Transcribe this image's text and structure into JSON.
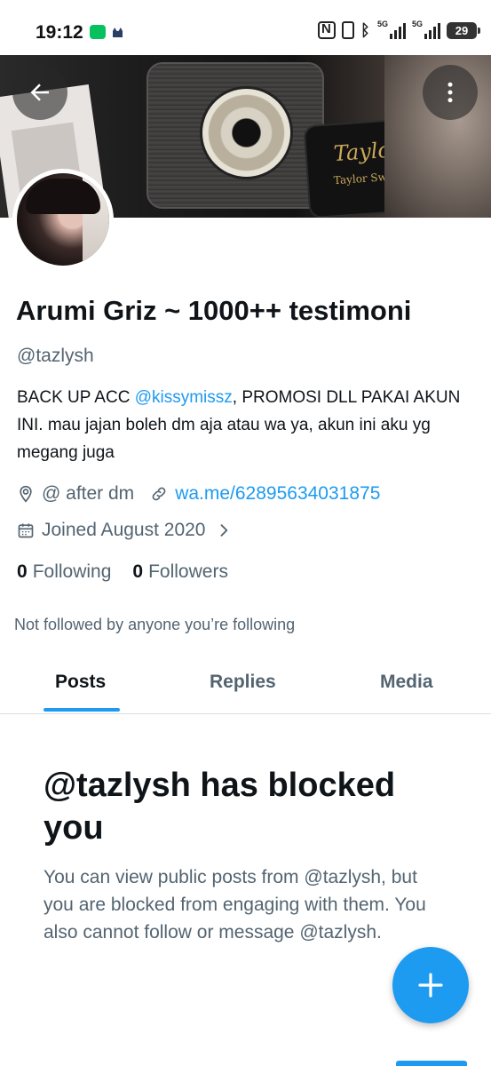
{
  "status_bar": {
    "time": "19:12",
    "network_labels": [
      "5G",
      "5G"
    ],
    "battery": "29"
  },
  "banner": {
    "pouch_text": "Taylor Swift",
    "pouch_signature": "Taylor"
  },
  "profile": {
    "name": "Arumi Griz ~ 1000++ testimoni",
    "handle": "@tazlysh",
    "bio_before": "BACK UP ACC ",
    "bio_mention": "@kissymissz",
    "bio_after": ", PROMOSI DLL PAKAI AKUN INI. mau jajan boleh dm aja atau wa ya, akun ini aku yg megang juga",
    "location": "@ after dm",
    "website": "wa.me/62895634031875",
    "joined": "Joined August 2020",
    "following_count": "0",
    "following_label": "Following",
    "followers_count": "0",
    "followers_label": "Followers",
    "not_followed_note": "Not followed by anyone you’re following"
  },
  "tabs": [
    {
      "label": "Posts",
      "active": true
    },
    {
      "label": "Replies",
      "active": false
    },
    {
      "label": "Media",
      "active": false
    }
  ],
  "blocked": {
    "title": "@tazlysh has blocked you",
    "description": "You can view public posts from @tazlysh, but you are blocked from engaging with them. You also cannot follow or message @tazlysh."
  },
  "colors": {
    "accent": "#1d9bf0",
    "secondary_text": "#536471",
    "primary_text": "#0f1419"
  },
  "icons": {
    "back": "arrow-left-icon",
    "more": "more-vertical-icon",
    "location": "location-pin-icon",
    "link": "link-icon",
    "calendar": "calendar-icon",
    "chevron": "chevron-right-icon",
    "compose": "plus-icon"
  }
}
